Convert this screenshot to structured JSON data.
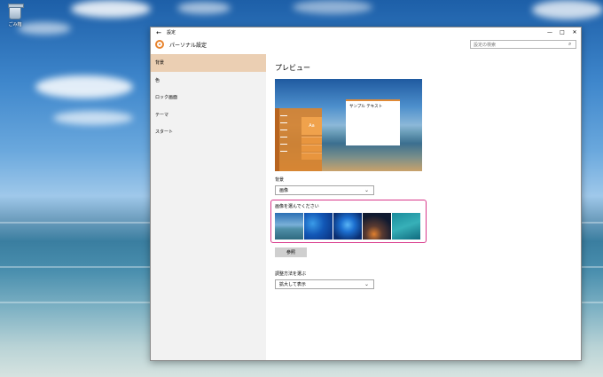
{
  "desktop": {
    "recycle_bin_label": "ごみ箱"
  },
  "window": {
    "title": "設定",
    "controls": {
      "minimize": "—",
      "maximize": "□",
      "close": "✕"
    },
    "back_glyph": "←",
    "app_title": "パーソナル設定",
    "search": {
      "placeholder": "設定の検索",
      "icon": "search-icon"
    }
  },
  "sidebar": {
    "items": [
      {
        "label": "背景",
        "active": true
      },
      {
        "label": "色",
        "active": false
      },
      {
        "label": "ロック画面",
        "active": false
      },
      {
        "label": "テーマ",
        "active": false
      },
      {
        "label": "スタート",
        "active": false
      }
    ]
  },
  "main": {
    "heading": "プレビュー",
    "preview": {
      "sample_text": "サンプル テキスト",
      "tile_label": "Aa"
    },
    "background": {
      "label": "背景",
      "value": "画像"
    },
    "picture_picker": {
      "label": "画像を選んでください"
    },
    "browse_button": "参照",
    "fit": {
      "label": "調整方法を選ぶ",
      "value": "拡大して表示"
    }
  },
  "colors": {
    "accent": "#e8842e",
    "sidebar_active": "#ebcfb3",
    "highlight_border": "#d8388a"
  }
}
